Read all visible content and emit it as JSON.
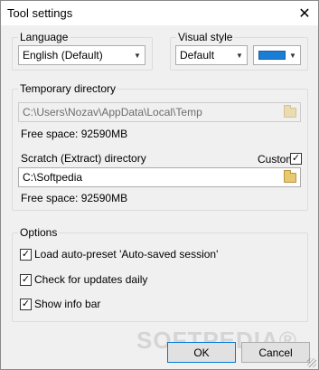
{
  "window": {
    "title": "Tool settings",
    "close_glyph": "✕"
  },
  "language": {
    "group_label": "Language",
    "selected": "English (Default)"
  },
  "visual_style": {
    "group_label": "Visual style",
    "selected": "Default",
    "accent_color": "#1a7fd4"
  },
  "temp_dir": {
    "group_label": "Temporary directory",
    "path": "C:\\Users\\Nozav\\AppData\\Local\\Temp",
    "free_space": "Free space: 92590MB",
    "scratch_label": "Scratch (Extract) directory",
    "custom_label": "Custom",
    "custom_checked": true,
    "scratch_path": "C:\\Softpedia",
    "scratch_free_space": "Free space: 92590MB"
  },
  "options": {
    "group_label": "Options",
    "items": [
      {
        "label": "Load auto-preset 'Auto-saved session'",
        "checked": true
      },
      {
        "label": "Check for updates daily",
        "checked": true
      },
      {
        "label": "Show info bar",
        "checked": true
      }
    ]
  },
  "footer": {
    "ok_label": "OK",
    "cancel_label": "Cancel",
    "watermark": "SOFTPEDIA®"
  },
  "icons": {
    "combo_arrow": "▼",
    "check": "✓",
    "folder": "folder-icon"
  }
}
